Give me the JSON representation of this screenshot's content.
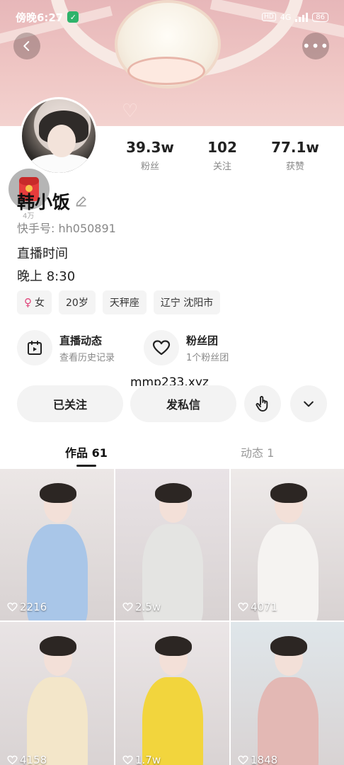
{
  "status_bar": {
    "time": "傍晚6:27",
    "network": "4G",
    "battery": "86"
  },
  "profile": {
    "name": "韩小饭",
    "kuaishou_id": "快手号: hh050891",
    "bio_lines": [
      "直播时间",
      "晚上 8:30"
    ],
    "redpacket_label": "4万"
  },
  "stats": [
    {
      "value": "39.3w",
      "label": "粉丝"
    },
    {
      "value": "102",
      "label": "关注"
    },
    {
      "value": "77.1w",
      "label": "获赞"
    }
  ],
  "tags": [
    "女",
    "20岁",
    "天秤座",
    "辽宁 沈阳市"
  ],
  "features": [
    {
      "title": "直播动态",
      "subtitle": "查看历史记录",
      "icon": "calendar-play-icon"
    },
    {
      "title": "粉丝团",
      "subtitle": "1个粉丝团",
      "icon": "heart-outline-icon"
    }
  ],
  "watermark": "mmp233.xyz",
  "actions": {
    "followed": "已关注",
    "message": "发私信"
  },
  "tabs": [
    {
      "label": "作品 61",
      "active": true
    },
    {
      "label": "动态 1",
      "active": false
    }
  ],
  "videos": [
    {
      "likes": "2216",
      "dress_color": "#a9c6e8",
      "bg": "#ece7e6"
    },
    {
      "likes": "2.5w",
      "dress_color": "#e4e4e2",
      "bg": "#e9e3e6"
    },
    {
      "likes": "4071",
      "dress_color": "#f5f3f1",
      "bg": "#eeeae9"
    },
    {
      "likes": "4158",
      "dress_color": "#f3e6c9",
      "bg": "#e9e4e5"
    },
    {
      "likes": "1.7w",
      "dress_color": "#f2d53d",
      "bg": "#ebe6e7"
    },
    {
      "likes": "1848",
      "dress_color": "#e3b8b4",
      "bg": "#dfe6ea"
    }
  ]
}
